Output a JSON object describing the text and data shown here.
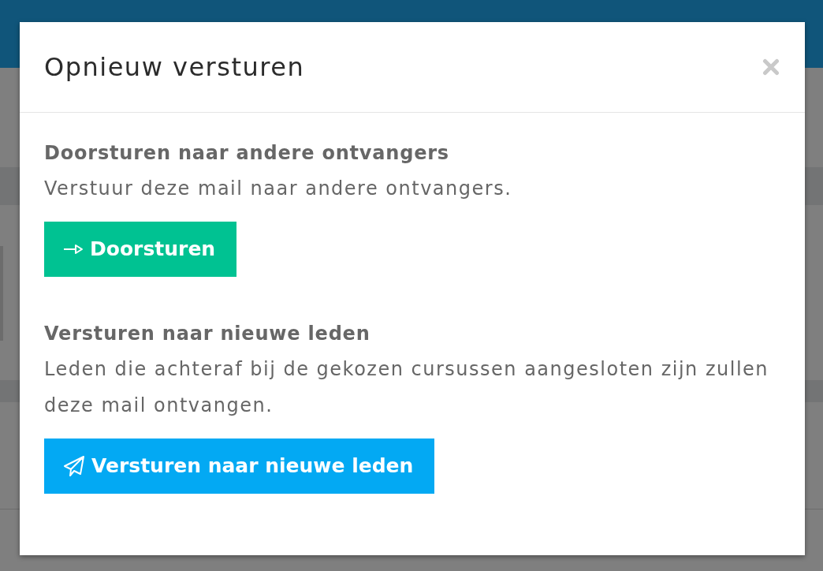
{
  "modal": {
    "title": "Opnieuw versturen",
    "sections": [
      {
        "heading": "Doorsturen naar andere ontvangers",
        "description": "Verstuur deze mail naar andere ontvangers.",
        "button": {
          "label": "Doorsturen",
          "kind": "forward"
        }
      },
      {
        "heading": "Versturen naar nieuwe leden",
        "description": "Leden die achteraf bij de gekozen cursussen aangesloten zijn zullen deze mail ontvangen.",
        "button": {
          "label": "Versturen naar nieuwe leden",
          "kind": "send"
        }
      }
    ]
  }
}
